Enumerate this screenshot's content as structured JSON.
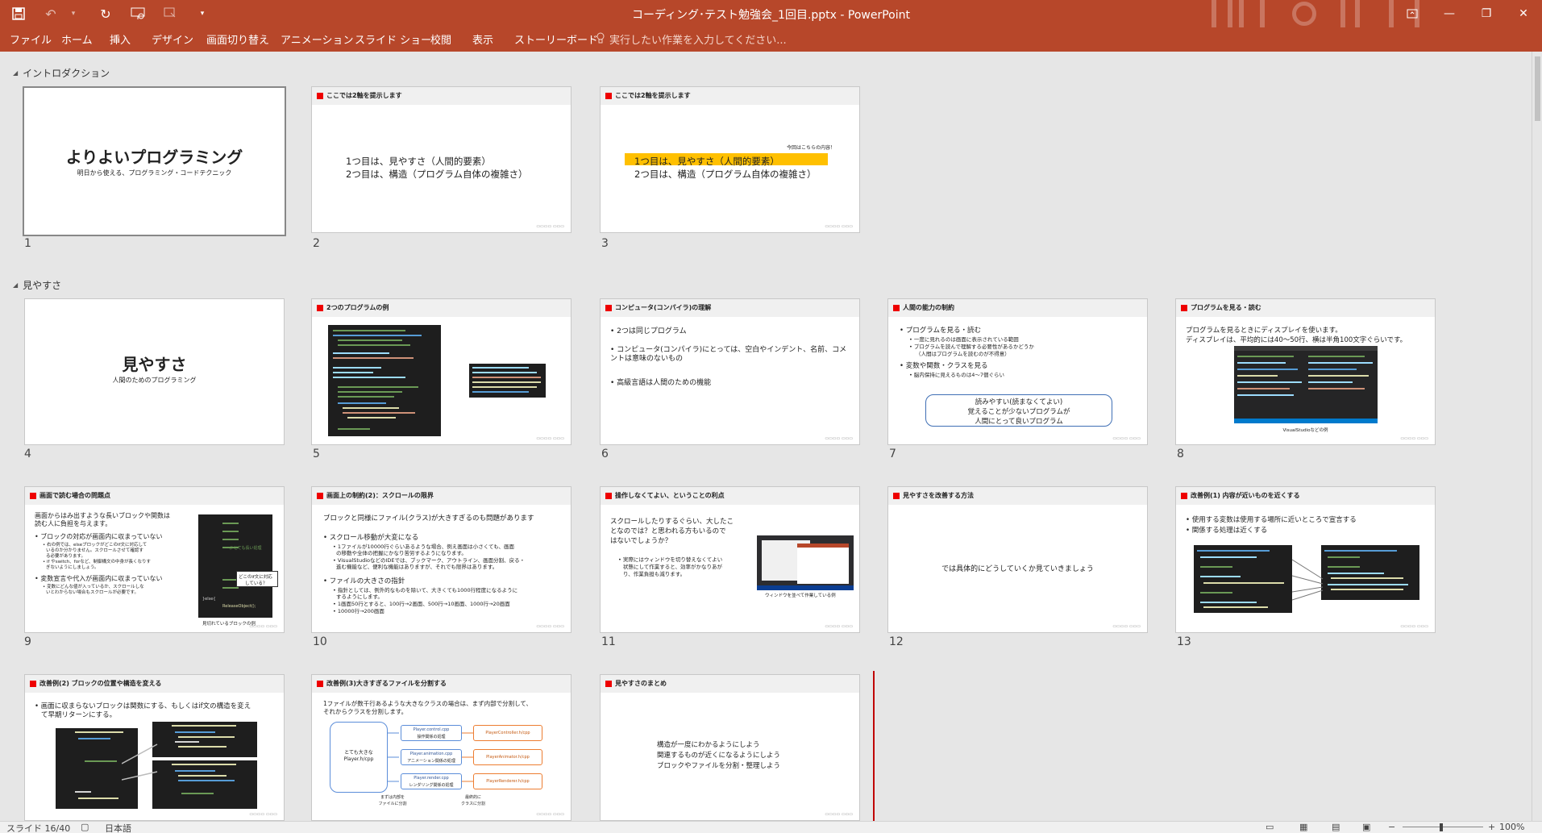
{
  "window": {
    "title": "コーディング･テスト勉強会_1回目.pptx - PowerPoint"
  },
  "ribbon": {
    "tabs": [
      "ファイル",
      "ホーム",
      "挿入",
      "デザイン",
      "画面切り替え",
      "アニメーション",
      "スライド ショー",
      "校閲",
      "表示",
      "ストーリーボード"
    ],
    "tell_me": "実行したい作業を入力してください..."
  },
  "sections": [
    {
      "name": "イントロダクション"
    },
    {
      "name": "見やすさ"
    }
  ],
  "slides": [
    {
      "num": "1",
      "title": "よりよいプログラミング",
      "subtitle": "明日から使える、プログラミング・コードテクニック"
    },
    {
      "num": "2",
      "header": "ここでは2軸を提示します",
      "lines": [
        "1つ目は、見やすさ（人間的要素）",
        "2つ目は、構造（プログラム自体の複雑さ）"
      ]
    },
    {
      "num": "3",
      "header": "ここでは2軸を提示します",
      "note": "今回はこちらの内容！",
      "lines": [
        "1つ目は、見やすさ（人間的要素）",
        "2つ目は、構造（プログラム自体の複雑さ）"
      ]
    },
    {
      "num": "4",
      "title": "見やすさ",
      "subtitle": "人間のためのプログラミング"
    },
    {
      "num": "5",
      "header": "2つのプログラムの例"
    },
    {
      "num": "6",
      "header": "コンピュータ(コンパイラ)の理解",
      "bullets": [
        "2つは同じプログラム",
        "コンピュータ(コンパイラ)にとっては、空白やインデント、名前、コメントは意味のないもの",
        "高級言語は人間のための機能"
      ]
    },
    {
      "num": "7",
      "header": "人間の能力の制約",
      "bullets": [
        "プログラムを見る・読む",
        "一度に見れるのは画面に表示されている範囲",
        "プログラムを読んで理解する必要性があるかどうか",
        "（人間はプログラムを読むのが不得意）",
        "変数や関数・クラスを見る",
        "脳内保持に見えるものは4〜7個ぐらい"
      ],
      "box": [
        "読みやすい(読まなくてよい)",
        "覚えることが少ないプログラムが",
        "人間にとって良いプログラム"
      ]
    },
    {
      "num": "8",
      "header": "プログラムを見る・読む",
      "lines": [
        "プログラムを見るときにディスプレイを使います。",
        "ディスプレイは、平均的には40〜50行、横は半角100文字ぐらいです。"
      ],
      "caption": "VisualStudioなどの例"
    },
    {
      "num": "9",
      "header": "画面で読む場合の問題点",
      "lead": [
        "画面からはみ出すような長いブロックや関数は",
        "読む人に負担を与えます。"
      ],
      "bullets": [
        "ブロックの対応が画面内に収まっていない",
        "右の例では、elseブロックがどこのif文に対応して",
        "いるのか分かりません。スクロールさせて確認す",
        "る必要があります。",
        "if やswitch、forなど、制御構文の中身が長くなりす",
        "ぎないようにしましょう。",
        "変数宣言や代入が画面内に収まっていない",
        "変数にどんな値が入っているか、スクロールしな",
        "いとわからない場合もスクロールが必要です。"
      ],
      "callout": [
        "どこのif文に対応",
        "している？"
      ],
      "caption": "見切れているブロックの例",
      "code_labels": [
        "// とても長い処理",
        "}else{",
        "ReleaseObject();"
      ]
    },
    {
      "num": "10",
      "header": "画面上の制約(2)：スクロールの限界",
      "lead": "ブロックと同様にファイル(クラス)が大きすぎるのも問題があります",
      "bullets": [
        "スクロール移動が大変になる",
        "1ファイルが10000行ぐらいあるような場合、例え画面は小さくても、画面",
        "の移動や全体の把握にかなり苦労するようになります。",
        "VisualStudioなどのIDEでは、ブックマーク、アウトライン、画面分割、戻る・",
        "進む機能など、便利な機能はありますが、それでも限界はあります。",
        "ファイルの大きさの指針",
        "指針としては、例外的なものを除いて、大きくても1000行程度になるように",
        "するようにします。",
        "1画面50行とすると、100行→2画面、500行→10画面、1000行→20画面",
        "10000行→200画面"
      ]
    },
    {
      "num": "11",
      "header": "操作しなくてよい、ということの利点",
      "lead": [
        "スクロールしたりするぐらい、大したこ",
        "となのでは？と思われる方もいるので",
        "はないでしょうか？"
      ],
      "bullets": [
        "実際にはウィンドウを切り替えなくてよい",
        "状態にして作業すると、効率がかなりあが",
        "り、作業負担も減ります。"
      ],
      "caption": "ウィンドウを並べて作業している例"
    },
    {
      "num": "12",
      "header": "見やすさを改善する方法",
      "lines": [
        "では具体的にどうしていくか見ていきましょう"
      ]
    },
    {
      "num": "13",
      "header": "改善例(1) 内容が近いものを近くする",
      "bullets": [
        "使用する変数は使用する場所に近いところで宣言する",
        "関係する処理は近くする"
      ]
    },
    {
      "num": "14",
      "header": "改善例(2) ブロックの位置や構造を変える",
      "bullets": [
        "画面に収まらないブロックは関数にする、もしくはif文の構造を変え",
        "て早期リターンにする。"
      ]
    },
    {
      "num": "15",
      "header": "改善例(3)大きすぎるファイルを分割する",
      "lead": [
        "1ファイルが数千行あるような大きなクラスの場合は、まず内部で分割して、",
        "それからクラスを分割します。"
      ],
      "big_box": [
        "とても大きな",
        "Player.h/cpp"
      ],
      "mid_boxes": [
        [
          "Player.control.cpp",
          "操作関係の処理"
        ],
        [
          "Player.animation.cpp",
          "アニメーション関係の処理"
        ],
        [
          "Player.render.cpp",
          "レンダリング関係の処理"
        ]
      ],
      "right_boxes": [
        "PlayerController.h/cpp",
        "PlayerAnimator.h/cpp",
        "PlayerRenderer.h/cpp"
      ],
      "captions": [
        [
          "まずは内部を",
          "ファイルに分割"
        ],
        [
          "最終的に",
          "クラスに分割"
        ]
      ]
    },
    {
      "num": "16",
      "header": "見やすさのまとめ",
      "lines": [
        "構造が一度にわかるようにしよう",
        "関連するものが近くになるようにしよう",
        "ブロックやファイルを分割・整理しよう"
      ]
    }
  ],
  "status": {
    "slide_indicator": "スライド 16/40",
    "language": "日本語",
    "zoom": "100%"
  }
}
